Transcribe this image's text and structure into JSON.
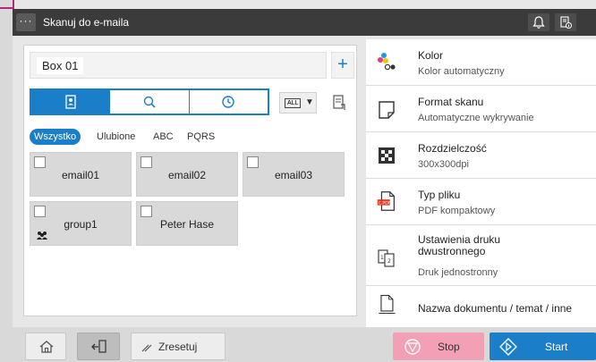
{
  "header": {
    "menu_label": "···",
    "title": "Skanuj do e-maila"
  },
  "box": {
    "value": "Box 01",
    "add_label": "+"
  },
  "view_toggle": {
    "all_label": "ALL"
  },
  "filters": [
    {
      "label": "Wszystko",
      "active": true
    },
    {
      "label": "Ulubione",
      "active": false
    },
    {
      "label": "ABC",
      "active": false
    },
    {
      "label": "PQRS",
      "active": false
    }
  ],
  "destinations": [
    {
      "label": "email01"
    },
    {
      "label": "email02"
    },
    {
      "label": "email03"
    },
    {
      "label": "group1",
      "is_group": true
    },
    {
      "label": "Peter Hase"
    }
  ],
  "settings": [
    {
      "title": "Kolor",
      "value": "Kolor automatyczny",
      "icon": "color-icon"
    },
    {
      "title": "Format skanu",
      "value": "Automatyczne wykrywanie",
      "icon": "scan-size-icon"
    },
    {
      "title": "Rozdzielczość",
      "value": "300x300dpi",
      "icon": "resolution-icon"
    },
    {
      "title": "Typ pliku",
      "value": "PDF kompaktowy",
      "icon": "file-type-icon",
      "icon_badge": "C.PDF"
    },
    {
      "title": "Ustawienia druku\ndwustronnego",
      "value": "Druk jednostronny",
      "icon": "duplex-icon"
    },
    {
      "title": "Nazwa dokumentu / temat / inne",
      "value": "",
      "icon": "document-name-icon"
    }
  ],
  "footer": {
    "reset_label": "Zresetuj",
    "stop_label": "Stop",
    "start_label": "Start"
  },
  "colors": {
    "accent": "#1a7ec8",
    "stop": "#f3a0b7",
    "topbar": "#3b3b3b"
  }
}
